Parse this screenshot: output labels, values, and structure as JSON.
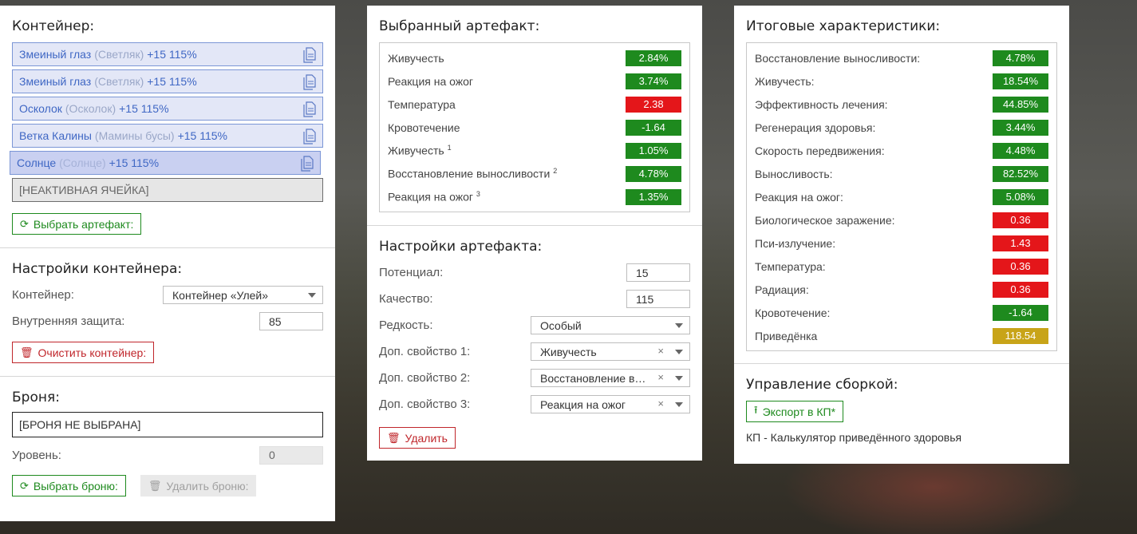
{
  "colors": {
    "green": "#1e8a1e",
    "red": "#e4161a",
    "gold": "#c8a418"
  },
  "container": {
    "title": "Контейнер:",
    "slots": [
      {
        "name": "Змеиный глаз",
        "sub": "(Светляк)",
        "level": "+15 115%"
      },
      {
        "name": "Змеиный глаз",
        "sub": "(Светляк)",
        "level": "+15 115%"
      },
      {
        "name": "Осколок",
        "sub": "(Осколок)",
        "level": "+15 115%"
      },
      {
        "name": "Ветка Калины",
        "sub": "(Мамины бусы)",
        "level": "+15 115%"
      },
      {
        "name": "Солнце",
        "sub": "(Солнце)",
        "level": "+15 115%"
      }
    ],
    "inactive_slot": "[НЕАКТИВНАЯ ЯЧЕЙКА]",
    "select_button": "Выбрать артефакт:"
  },
  "container_settings": {
    "title": "Настройки контейнера:",
    "container_label": "Контейнер:",
    "container_value": "Контейнер «Улей»",
    "protection_label": "Внутренняя защита:",
    "protection_value": "85",
    "clear_button": "Очистить контейнер:"
  },
  "armor": {
    "title": "Броня:",
    "value": "[БРОНЯ НЕ ВЫБРАНА]",
    "level_label": "Уровень:",
    "level_value": "0",
    "select_button": "Выбрать броню:",
    "delete_button": "Удалить броню:"
  },
  "artifact": {
    "title": "Выбранный артефакт:",
    "stats": [
      {
        "label": "Живучесть",
        "sup": "",
        "value": "2.84%",
        "color": "green"
      },
      {
        "label": "Реакция на ожог",
        "sup": "",
        "value": "3.74%",
        "color": "green"
      },
      {
        "label": "Температура",
        "sup": "",
        "value": "2.38",
        "color": "red"
      },
      {
        "label": "Кровотечение",
        "sup": "",
        "value": "-1.64",
        "color": "green"
      },
      {
        "label": "Живучесть",
        "sup": "1",
        "value": "1.05%",
        "color": "green"
      },
      {
        "label": "Восстановление выносливости",
        "sup": "2",
        "value": "4.78%",
        "color": "green"
      },
      {
        "label": "Реакция на ожог",
        "sup": "3",
        "value": "1.35%",
        "color": "green"
      }
    ]
  },
  "artifact_settings": {
    "title": "Настройки артефакта:",
    "potential_label": "Потенциал:",
    "potential_value": "15",
    "quality_label": "Качество:",
    "quality_value": "115",
    "rarity_label": "Редкость:",
    "rarity_value": "Особый",
    "prop1_label": "Доп. свойство 1:",
    "prop1_value": "Живучесть",
    "prop2_label": "Доп. свойство 2:",
    "prop2_value": "Восстановление в…",
    "prop3_label": "Доп. свойство 3:",
    "prop3_value": "Реакция на ожог",
    "clear_symbol": "×",
    "delete_button": "Удалить"
  },
  "totals": {
    "title": "Итоговые характеристики:",
    "stats": [
      {
        "label": "Восстановление выносливости:",
        "value": "4.78%",
        "color": "green"
      },
      {
        "label": "Живучесть:",
        "value": "18.54%",
        "color": "green"
      },
      {
        "label": "Эффективность лечения:",
        "value": "44.85%",
        "color": "green"
      },
      {
        "label": "Регенерация здоровья:",
        "value": "3.44%",
        "color": "green"
      },
      {
        "label": "Скорость передвижения:",
        "value": "4.48%",
        "color": "green"
      },
      {
        "label": "Выносливость:",
        "value": "82.52%",
        "color": "green"
      },
      {
        "label": "Реакция на ожог:",
        "value": "5.08%",
        "color": "green"
      },
      {
        "label": "Биологическое заражение:",
        "value": "0.36",
        "color": "red"
      },
      {
        "label": "Пси-излучение:",
        "value": "1.43",
        "color": "red"
      },
      {
        "label": "Температура:",
        "value": "0.36",
        "color": "red"
      },
      {
        "label": "Радиация:",
        "value": "0.36",
        "color": "red"
      },
      {
        "label": "Кровотечение:",
        "value": "-1.64",
        "color": "green"
      },
      {
        "label": "Приведёнка",
        "value": "118.54",
        "color": "gold"
      }
    ]
  },
  "build": {
    "title": "Управление сборкой:",
    "export_button": "Экспорт в КП*",
    "note": "КП - Калькулятор приведённого здоровья"
  }
}
